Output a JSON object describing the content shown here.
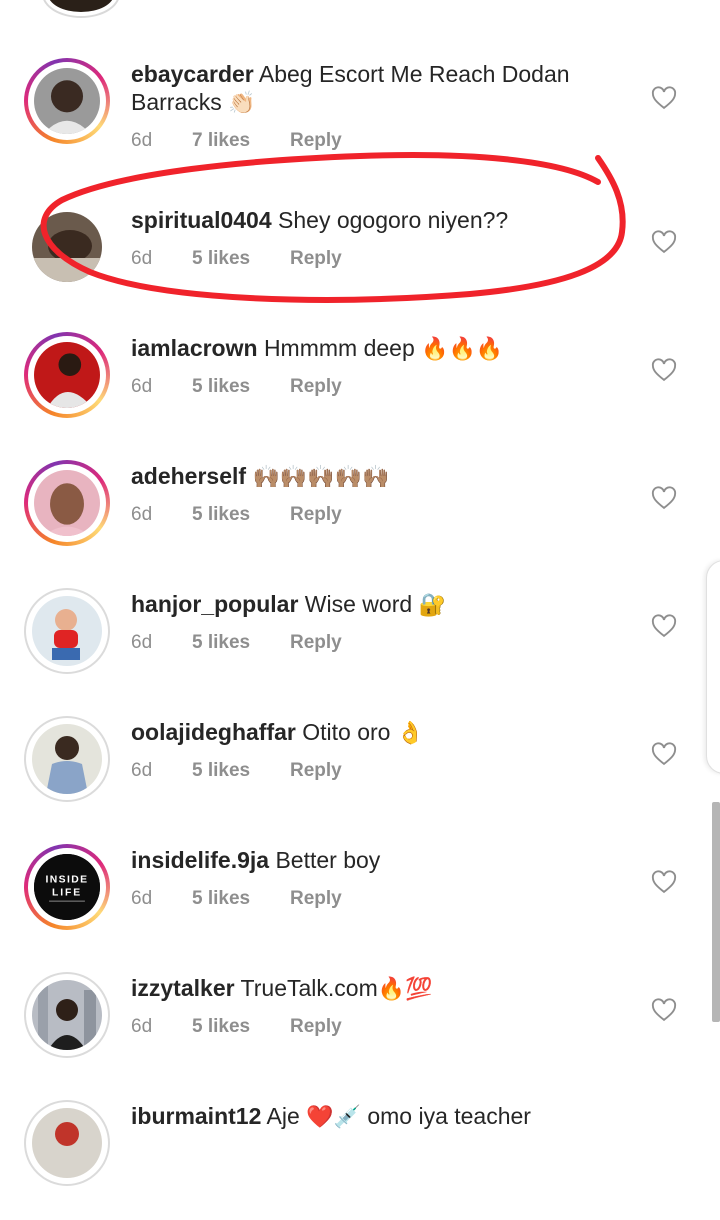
{
  "comments": [
    {
      "username": "ebaycarder",
      "text": "Abeg Escort Me Reach Dodan Barracks",
      "emoji": "👏🏻",
      "time": "6d",
      "likes": "7 likes",
      "reply": "Reply",
      "avatar_icon": "person-portrait-icon",
      "ring": "story"
    },
    {
      "username": "spiritual0404",
      "text": "Shey ogogoro niyen??",
      "emoji": "",
      "time": "6d",
      "likes": "5 likes",
      "reply": "Reply",
      "avatar_icon": "person-portrait-icon",
      "ring": "none"
    },
    {
      "username": "iamlacrown",
      "text": "Hmmmm deep",
      "emoji": "🔥🔥🔥",
      "time": "6d",
      "likes": "5 likes",
      "reply": "Reply",
      "avatar_icon": "person-portrait-icon",
      "ring": "story"
    },
    {
      "username": "adeherself",
      "text": "",
      "emoji": "🙌🏽🙌🏽🙌🏽🙌🏽🙌🏽",
      "time": "6d",
      "likes": "5 likes",
      "reply": "Reply",
      "avatar_icon": "person-portrait-icon",
      "ring": "story"
    },
    {
      "username": "hanjor_popular",
      "text": "Wise word",
      "emoji": "🔐",
      "time": "6d",
      "likes": "5 likes",
      "reply": "Reply",
      "avatar_icon": "child-portrait-icon",
      "ring": "seen"
    },
    {
      "username": "oolajideghaffar",
      "text": "Otito oro",
      "emoji": "👌",
      "time": "6d",
      "likes": "5 likes",
      "reply": "Reply",
      "avatar_icon": "person-portrait-icon",
      "ring": "seen"
    },
    {
      "username": "insidelife.9ja",
      "text": "Better boy",
      "emoji": "",
      "time": "6d",
      "likes": "5 likes",
      "reply": "Reply",
      "avatar_icon": "inside-life-logo-icon",
      "ring": "story"
    },
    {
      "username": "izzytalker",
      "text": "TrueTalk.com",
      "emoji": "🔥💯",
      "time": "6d",
      "likes": "5 likes",
      "reply": "Reply",
      "avatar_icon": "person-portrait-icon",
      "ring": "seen"
    },
    {
      "username": "iburmaint12",
      "text": "Aje",
      "emoji": "❤️💉",
      "text2": "omo iya teacher",
      "avatar_icon": "person-portrait-icon",
      "ring": "seen"
    }
  ],
  "inside_life_logo": {
    "line1": "INSIDE",
    "line2": "LIFE"
  },
  "colors": {
    "username": "#262626",
    "meta": "#8e8e8e",
    "annotation_red": "#f0232b"
  }
}
